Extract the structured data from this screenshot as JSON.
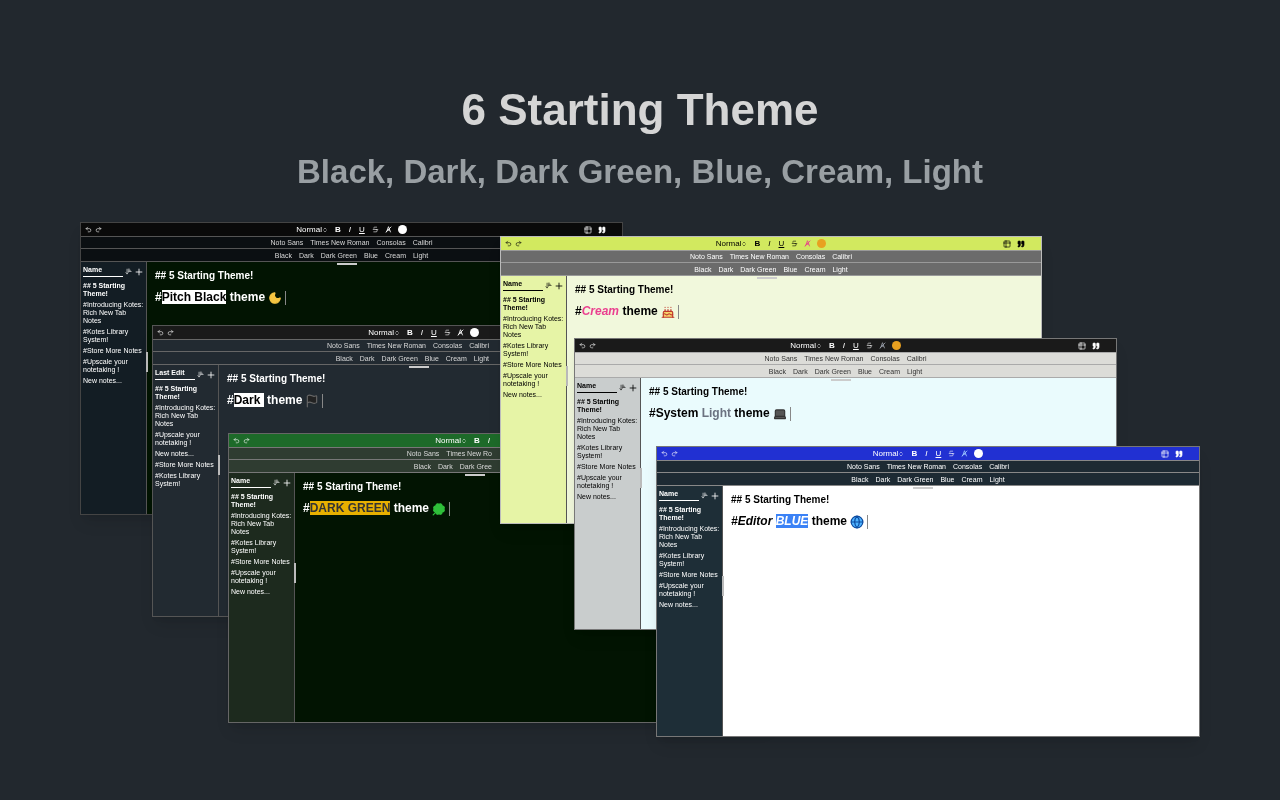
{
  "title": "6 Starting Theme",
  "subtitle": "Black, Dark, Dark Green, Blue, Cream, Light",
  "windows": [
    {
      "kind": "black",
      "toolbar": {
        "style": "Normal",
        "tools": [
          {
            "kind": "bold",
            "label": "B"
          },
          {
            "kind": "italic",
            "label": "I"
          },
          {
            "kind": "underline",
            "label": "U"
          },
          {
            "kind": "strike"
          },
          {
            "kind": "color"
          },
          {
            "kind": "swatch"
          }
        ]
      },
      "fonts": [
        "Noto Sans",
        "Times New Roman",
        "Consolas",
        "Calibri"
      ],
      "themes": [
        "Black",
        "Dark",
        "Dark Green",
        "Blue",
        "Cream",
        "Light"
      ],
      "sidebar": {
        "sort_label": "Name",
        "notes": [
          {
            "title": "## 5 Starting Theme!",
            "selected": true
          },
          {
            "title": "#Introducing Kotes: Rich New Tab Notes",
            "selected": false
          },
          {
            "title": "#Kotes Library System!",
            "selected": false
          },
          {
            "title": "#Store More Notes",
            "selected": false
          },
          {
            "title": "#Upscale your notetaking !",
            "selected": false
          },
          {
            "title": "New notes...",
            "selected": false
          }
        ]
      },
      "heading": "## 5 Starting Theme!",
      "line": [
        {
          "text": "#",
          "kind": "plain"
        },
        {
          "text": "Pitch Black",
          "kind": "highlight"
        },
        {
          "text": " theme",
          "kind": "plain"
        }
      ]
    },
    {
      "kind": "dark",
      "toolbar": {
        "style": "Normal",
        "tools": [
          {
            "kind": "bold",
            "label": "B"
          },
          {
            "kind": "italic",
            "label": "I"
          },
          {
            "kind": "underline",
            "label": "U"
          },
          {
            "kind": "strike"
          },
          {
            "kind": "color"
          },
          {
            "kind": "swatch"
          }
        ]
      },
      "fonts": [
        "Noto Sans",
        "Times New Roman",
        "Consolas",
        "Calibri"
      ],
      "themes": [
        "Black",
        "Dark",
        "Dark Green",
        "Blue",
        "Cream",
        "Light"
      ],
      "sidebar": {
        "sort_label": "Last Edit",
        "notes": [
          {
            "title": "## 5 Starting Theme!",
            "selected": true
          },
          {
            "title": "#Introducing Kotes: Rich New Tab Notes",
            "selected": false
          },
          {
            "title": "#Upscale your notetaking !",
            "selected": false
          },
          {
            "title": "New notes...",
            "selected": false
          },
          {
            "title": "#Store More Notes",
            "selected": false
          },
          {
            "title": "#Kotes Library System!",
            "selected": false
          }
        ]
      },
      "heading": "## 5 Starting Theme!",
      "line": [
        {
          "text": "#",
          "kind": "plain"
        },
        {
          "text": "Dark ",
          "kind": "highlight"
        },
        {
          "text": " theme",
          "kind": "plain"
        }
      ]
    },
    {
      "kind": "green",
      "toolbar": {
        "style": "Normal",
        "tools": [
          {
            "kind": "bold",
            "label": "B"
          },
          {
            "kind": "italic",
            "label": "I"
          }
        ]
      },
      "fonts": [
        "Noto Sans",
        "Times New Ro"
      ],
      "themes": [
        "Black",
        "Dark",
        "Dark Gree"
      ],
      "sidebar": {
        "sort_label": "Name",
        "notes": [
          {
            "title": "## 5 Starting Theme!",
            "selected": true
          },
          {
            "title": "#Introducing Kotes: Rich New Tab Notes",
            "selected": false
          },
          {
            "title": "#Kotes Library System!",
            "selected": false
          },
          {
            "title": "#Store More Notes",
            "selected": false
          },
          {
            "title": "#Upscale your notetaking !",
            "selected": false
          },
          {
            "title": "New notes...",
            "selected": false
          }
        ]
      },
      "heading": "## 5 Starting Theme!",
      "line": [
        {
          "text": "#",
          "kind": "plain"
        },
        {
          "text": "DARK GREEN",
          "kind": "highlight"
        },
        {
          "text": " theme",
          "kind": "plain"
        }
      ]
    },
    {
      "kind": "cream",
      "toolbar": {
        "style": "Normal",
        "tools": [
          {
            "kind": "bold",
            "label": "B"
          },
          {
            "kind": "italic",
            "label": "I"
          },
          {
            "kind": "underline",
            "label": "U"
          },
          {
            "kind": "strike"
          },
          {
            "kind": "color"
          },
          {
            "kind": "swatch"
          }
        ]
      },
      "fonts": [
        "Noto Sans",
        "Times New Roman",
        "Consolas",
        "Calibri"
      ],
      "themes": [
        "Black",
        "Dark",
        "Dark Green",
        "Blue",
        "Cream",
        "Light"
      ],
      "sidebar": {
        "sort_label": "Name",
        "notes": [
          {
            "title": "## 5 Starting Theme!",
            "selected": true
          },
          {
            "title": "#Introducing Kotes: Rich New Tab Notes",
            "selected": false
          },
          {
            "title": "#Kotes Library System!",
            "selected": false
          },
          {
            "title": "#Store More Notes",
            "selected": false
          },
          {
            "title": "#Upscale your notetaking !",
            "selected": false
          },
          {
            "title": "New notes...",
            "selected": false
          }
        ]
      },
      "heading": "## 5 Starting Theme!",
      "line": [
        {
          "text": "#",
          "kind": "plain"
        },
        {
          "text": "Cream",
          "kind": "accent"
        },
        {
          "text": " theme",
          "kind": "plain"
        }
      ]
    },
    {
      "kind": "light",
      "toolbar": {
        "style": "Normal",
        "tools": [
          {
            "kind": "bold",
            "label": "B"
          },
          {
            "kind": "italic",
            "label": "I"
          },
          {
            "kind": "underline",
            "label": "U"
          },
          {
            "kind": "strike"
          },
          {
            "kind": "color"
          },
          {
            "kind": "swatch"
          }
        ]
      },
      "fonts": [
        "Noto Sans",
        "Times New Roman",
        "Consolas",
        "Calibri"
      ],
      "themes": [
        "Black",
        "Dark",
        "Dark Green",
        "Blue",
        "Cream",
        "Light"
      ],
      "sidebar": {
        "sort_label": "Name",
        "notes": [
          {
            "title": "## 5 Starting Theme!",
            "selected": true
          },
          {
            "title": "#Introducing Kotes: Rich New Tab Notes",
            "selected": false
          },
          {
            "title": "#Kotes Library System!",
            "selected": false
          },
          {
            "title": "#Store More Notes",
            "selected": false
          },
          {
            "title": "#Upscale your notetaking !",
            "selected": false
          },
          {
            "title": "New notes...",
            "selected": false
          }
        ]
      },
      "heading": "## 5 Starting Theme!",
      "line": [
        {
          "text": "#System ",
          "kind": "plain"
        },
        {
          "text": "Light",
          "kind": "muted"
        },
        {
          "text": " theme",
          "kind": "plain"
        }
      ]
    },
    {
      "kind": "blue",
      "toolbar": {
        "style": "Normal",
        "tools": [
          {
            "kind": "bold",
            "label": "B"
          },
          {
            "kind": "italic",
            "label": "I"
          },
          {
            "kind": "underline",
            "label": "U"
          },
          {
            "kind": "strike"
          },
          {
            "kind": "color"
          },
          {
            "kind": "swatch"
          }
        ]
      },
      "fonts": [
        "Noto Sans",
        "Times New Roman",
        "Consolas",
        "Calibri"
      ],
      "themes": [
        "Black",
        "Dark",
        "Dark Green",
        "Blue",
        "Cream",
        "Light"
      ],
      "sidebar": {
        "sort_label": "Name",
        "notes": [
          {
            "title": "## 5 Starting Theme!",
            "selected": true
          },
          {
            "title": "#Introducing Kotes: Rich New Tab Notes",
            "selected": false
          },
          {
            "title": "#Kotes Library System!",
            "selected": false
          },
          {
            "title": "#Store More Notes",
            "selected": false
          },
          {
            "title": "#Upscale your notetaking !",
            "selected": false
          },
          {
            "title": "New notes...",
            "selected": false
          }
        ]
      },
      "heading": "## 5 Starting Theme!",
      "line": [
        {
          "text": "#",
          "kind": "italic"
        },
        {
          "text": "Editor ",
          "kind": "italic"
        },
        {
          "text": "BLUE",
          "kind": "highlight"
        },
        {
          "text": " theme",
          "kind": "plain"
        }
      ]
    }
  ]
}
